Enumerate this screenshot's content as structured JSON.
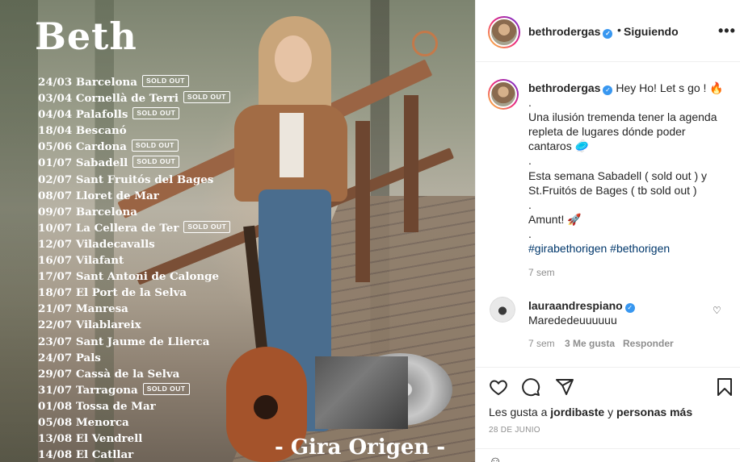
{
  "poster": {
    "title": "Beth",
    "sold_out_label": "SOLD OUT",
    "tour_dates": [
      {
        "text": "24/03 Barcelona",
        "sold_out": true
      },
      {
        "text": "03/04 Cornellà de Terri",
        "sold_out": true
      },
      {
        "text": "04/04 Palafolls",
        "sold_out": true
      },
      {
        "text": "18/04 Bescanó",
        "sold_out": false
      },
      {
        "text": "05/06 Cardona",
        "sold_out": true
      },
      {
        "text": "01/07 Sabadell",
        "sold_out": true
      },
      {
        "text": "02/07 Sant Fruitós del Bages",
        "sold_out": false
      },
      {
        "text": "08/07 Lloret de Mar",
        "sold_out": false
      },
      {
        "text": "09/07 Barcelona",
        "sold_out": false
      },
      {
        "text": "10/07 La Cellera de Ter",
        "sold_out": true
      },
      {
        "text": "12/07 Viladecavalls",
        "sold_out": false
      },
      {
        "text": "16/07 Vilafant",
        "sold_out": false
      },
      {
        "text": "17/07 Sant Antoni de Calonge",
        "sold_out": false
      },
      {
        "text": "18/07 El Port de la Selva",
        "sold_out": false
      },
      {
        "text": "21/07 Manresa",
        "sold_out": false
      },
      {
        "text": "22/07 Vilablareix",
        "sold_out": false
      },
      {
        "text": "23/07 Sant Jaume de Llierca",
        "sold_out": false
      },
      {
        "text": "24/07 Pals",
        "sold_out": false
      },
      {
        "text": "29/07 Cassà de la Selva",
        "sold_out": false
      },
      {
        "text": "31/07 Tarragona",
        "sold_out": true
      },
      {
        "text": "01/08 Tossa de Mar",
        "sold_out": false
      },
      {
        "text": "05/08 Menorca",
        "sold_out": false
      },
      {
        "text": "13/08 El Vendrell",
        "sold_out": false
      },
      {
        "text": "14/08 El Catllar",
        "sold_out": false
      }
    ],
    "footer_title": "- Gira Origen -"
  },
  "header": {
    "username": "bethrodergas",
    "separator": "•",
    "follow_status": "Siguiendo",
    "more_icon": "more-options-icon"
  },
  "caption": {
    "username": "bethrodergas",
    "lines": [
      "Hey Ho! Let s go ! 🔥",
      ".",
      "Una ilusión tremenda tener la agenda repleta de lugares dónde poder cantaros 🥏",
      ".",
      "Esta semana Sabadell ( sold out ) y St.Fruitós de Bages ( tb sold out )",
      ".",
      "Amunt! 🚀",
      "."
    ],
    "hashtags": "#girabethorigen #bethorigen",
    "time": "7 sem"
  },
  "comment": {
    "username": "lauraandrespiano",
    "text": "Marededeuuuuuu",
    "time": "7 sem",
    "likes": "3 Me gusta",
    "reply": "Responder"
  },
  "actions": {
    "like_icon": "heart-icon",
    "comment_icon": "comment-icon",
    "share_icon": "share-icon",
    "save_icon": "bookmark-icon"
  },
  "likes": {
    "prefix": "Les gusta a",
    "user": "jordibaste",
    "middle": "y",
    "others": "personas más"
  },
  "post_date": "28 DE JUNIO"
}
